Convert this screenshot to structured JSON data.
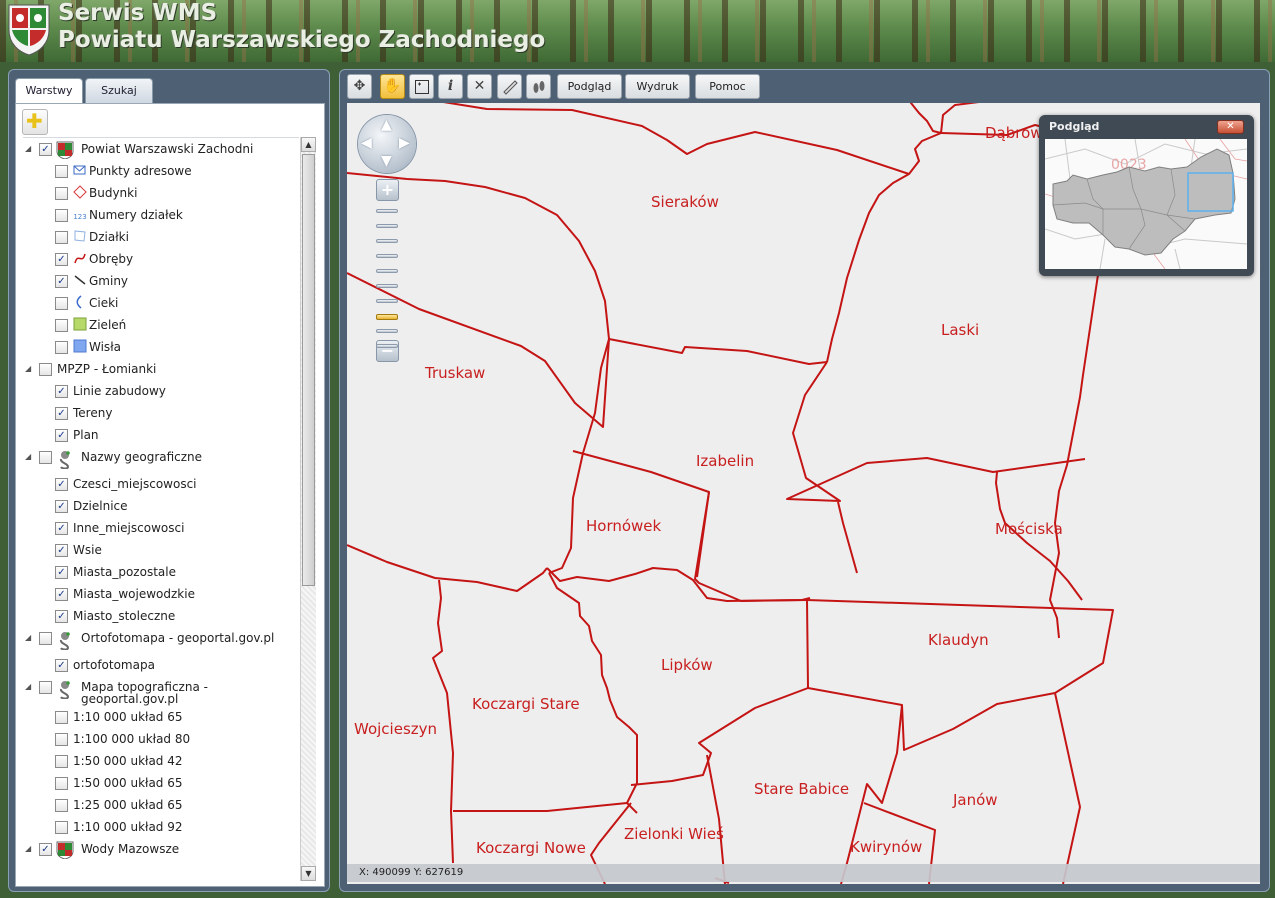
{
  "header": {
    "title_line1": "Serwis WMS",
    "title_line2": "Powiatu Warszawskiego Zachodniego"
  },
  "tabs": [
    {
      "label": "Warstwy",
      "active": true
    },
    {
      "label": "Szukaj",
      "active": false
    }
  ],
  "toolbar": {
    "icons": [
      "pan-icon",
      "hand-icon",
      "zoom-box-icon",
      "info-icon",
      "tools-icon",
      "ruler-icon",
      "footprint-icon"
    ],
    "buttons": [
      "Podgląd",
      "Wydruk",
      "Pomoc"
    ]
  },
  "layers": [
    {
      "label": "Powiat Warszawski Zachodni",
      "checked": true,
      "level": 0,
      "icon": "coat-of-arms-icon",
      "expanded": true
    },
    {
      "label": "Punkty adresowe",
      "checked": false,
      "level": 1,
      "icon": "envelope-icon"
    },
    {
      "label": "Budynki",
      "checked": false,
      "level": 1,
      "icon": "diamond-icon"
    },
    {
      "label": "Numery działek",
      "checked": false,
      "level": 1,
      "icon": "number-icon"
    },
    {
      "label": "Działki",
      "checked": false,
      "level": 1,
      "icon": "parcel-icon"
    },
    {
      "label": "Obręby",
      "checked": true,
      "level": 1,
      "icon": "red-line-icon"
    },
    {
      "label": "Gminy",
      "checked": true,
      "level": 1,
      "icon": "dark-line-icon"
    },
    {
      "label": "Cieki",
      "checked": false,
      "level": 1,
      "icon": "stream-icon"
    },
    {
      "label": "Zieleń",
      "checked": false,
      "level": 1,
      "icon": "green-square-icon"
    },
    {
      "label": "Wisła",
      "checked": false,
      "level": 1,
      "icon": "blue-square-icon"
    },
    {
      "label": "MPZP - Łomianki",
      "checked": false,
      "level": 0,
      "icon": "",
      "expanded": true
    },
    {
      "label": "Linie zabudowy",
      "checked": true,
      "level": 2,
      "icon": ""
    },
    {
      "label": "Tereny",
      "checked": true,
      "level": 2,
      "icon": ""
    },
    {
      "label": "Plan",
      "checked": true,
      "level": 2,
      "icon": ""
    },
    {
      "label": "Nazwy geograficzne",
      "checked": false,
      "level": 0,
      "icon": "geoportal-icon",
      "expanded": true
    },
    {
      "label": "Czesci_miejscowosci",
      "checked": true,
      "level": 2,
      "icon": ""
    },
    {
      "label": "Dzielnice",
      "checked": true,
      "level": 2,
      "icon": ""
    },
    {
      "label": "Inne_miejscowosci",
      "checked": true,
      "level": 2,
      "icon": ""
    },
    {
      "label": "Wsie",
      "checked": true,
      "level": 2,
      "icon": ""
    },
    {
      "label": "Miasta_pozostale",
      "checked": true,
      "level": 2,
      "icon": ""
    },
    {
      "label": "Miasta_wojewodzkie",
      "checked": true,
      "level": 2,
      "icon": ""
    },
    {
      "label": "Miasto_stoleczne",
      "checked": true,
      "level": 2,
      "icon": ""
    },
    {
      "label": "Ortofotomapa - geoportal.gov.pl",
      "checked": false,
      "level": 0,
      "icon": "geoportal-icon",
      "expanded": true
    },
    {
      "label": "ortofotomapa",
      "checked": true,
      "level": 2,
      "icon": ""
    },
    {
      "label": "Mapa topograficzna -",
      "label2": "geoportal.gov.pl",
      "checked": false,
      "level": 0,
      "icon": "geoportal-icon",
      "expanded": true
    },
    {
      "label": "1:10 000 układ 65",
      "checked": false,
      "level": 2,
      "icon": ""
    },
    {
      "label": "1:100 000 układ 80",
      "checked": false,
      "level": 2,
      "icon": ""
    },
    {
      "label": "1:50 000 układ 42",
      "checked": false,
      "level": 2,
      "icon": ""
    },
    {
      "label": "1:50 000 układ 65",
      "checked": false,
      "level": 2,
      "icon": ""
    },
    {
      "label": "1:25 000 układ 65",
      "checked": false,
      "level": 2,
      "icon": ""
    },
    {
      "label": "1:10 000 układ 92",
      "checked": false,
      "level": 2,
      "icon": ""
    },
    {
      "label": "Wody Mazowsze",
      "checked": true,
      "level": 0,
      "icon": "coat-of-arms-icon",
      "expanded": true
    }
  ],
  "map": {
    "places": [
      "Dąbrowa",
      "Sieraków",
      "Laski",
      "Truskaw",
      "Izabelin",
      "Hornówek",
      "Mościska",
      "Klaudyn",
      "Lipków",
      "Koczargi Stare",
      "Wojcieszyn",
      "Stare Babice",
      "Janów",
      "Koczargi Nowe",
      "Zielonki Wieś",
      "Kwirynów"
    ],
    "zoom_levels": 10,
    "zoom_current": 7
  },
  "overview": {
    "title": "Podgląd",
    "label": "0023"
  },
  "status": {
    "coords": "X: 490099 Y: 627619"
  },
  "colors": {
    "boundary": "#c41414",
    "place_label": "#c81f1f",
    "panel_bg": "#4e6073"
  }
}
